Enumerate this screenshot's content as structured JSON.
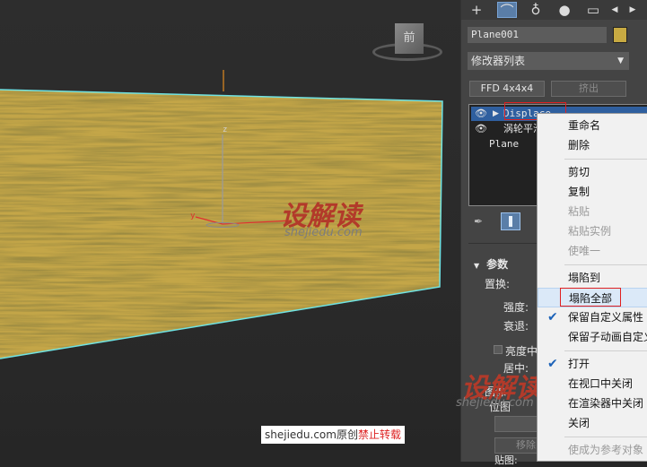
{
  "viewport": {
    "viewcube_label": "前",
    "axis_z": "z",
    "axis_y": "y",
    "watermark_logo": "设解读",
    "watermark_site": "shejiedu.com",
    "banner_site": "shejiedu.com原创",
    "banner_warning": "禁止转载",
    "plane_color": "#c4a648",
    "edge_color": "#6fe3e3"
  },
  "panel": {
    "tabs": [
      {
        "icon": "plus-icon",
        "glyph": "+"
      },
      {
        "icon": "modify-icon",
        "glyph": "⌒"
      },
      {
        "icon": "hierarchy-icon",
        "glyph": "♁"
      },
      {
        "icon": "motion-icon",
        "glyph": "●"
      },
      {
        "icon": "display-icon",
        "glyph": "▭"
      },
      {
        "icon": "scroll-left-icon",
        "glyph": "◀"
      },
      {
        "icon": "scroll-right-icon",
        "glyph": "▶"
      }
    ],
    "object_name": "Plane001",
    "object_color": "#c8aa42",
    "modifier_list_label": "修改器列表",
    "buttons": {
      "ffd": "FFD 4x4x4",
      "extrude": "挤出"
    },
    "stack": [
      {
        "name": "Displace",
        "eye": "👁",
        "expand": "▶"
      },
      {
        "name": "涡轮平滑",
        "eye": "👁",
        "expand": ""
      },
      {
        "name": "Plane",
        "eye": "",
        "expand": ""
      }
    ],
    "rollout": {
      "title": "参数",
      "displace_label": "置换:",
      "strength_label": "强度:",
      "decay_label": "衰退:",
      "luminance_label": "亮度中",
      "center_label": "居中:",
      "image_label": "图像",
      "bitmap_label": "位图",
      "move_button": "移除",
      "map_label": "贴图:"
    }
  },
  "context_menu": {
    "items": [
      {
        "label": "重命名",
        "enabled": true,
        "checked": false
      },
      {
        "label": "删除",
        "enabled": true,
        "checked": false
      },
      {
        "label": "剪切",
        "enabled": true,
        "checked": false
      },
      {
        "label": "复制",
        "enabled": true,
        "checked": false
      },
      {
        "label": "粘贴",
        "enabled": false,
        "checked": false
      },
      {
        "label": "粘贴实例",
        "enabled": false,
        "checked": false
      },
      {
        "label": "使唯一",
        "enabled": false,
        "checked": false
      },
      {
        "label": "塌陷到",
        "enabled": true,
        "checked": false
      },
      {
        "label": "塌陷全部",
        "enabled": true,
        "checked": false
      },
      {
        "label": "保留自定义属性",
        "enabled": true,
        "checked": true
      },
      {
        "label": "保留子动画自定义",
        "enabled": true,
        "checked": false
      },
      {
        "label": "打开",
        "enabled": true,
        "checked": true
      },
      {
        "label": "在视口中关闭",
        "enabled": true,
        "checked": false
      },
      {
        "label": "在渲染器中关闭",
        "enabled": true,
        "checked": false
      },
      {
        "label": "关闭",
        "enabled": true,
        "checked": false
      },
      {
        "label": "使成为参考对象",
        "enabled": false,
        "checked": false
      }
    ]
  }
}
